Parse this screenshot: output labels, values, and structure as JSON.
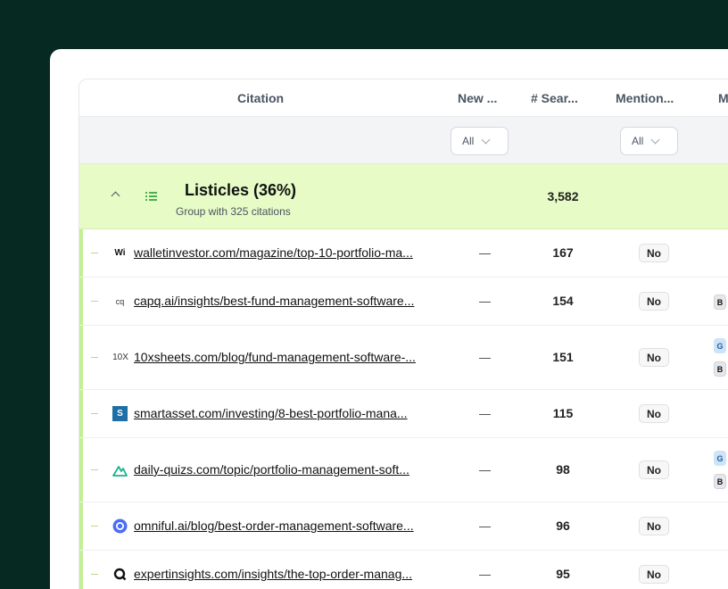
{
  "columns": {
    "citation": "Citation",
    "new": "New ...",
    "searches": "# Sear...",
    "mention": "Mention...",
    "more": "M"
  },
  "filters": {
    "new_value": "All",
    "mention_value": "All"
  },
  "group": {
    "title": "Listicles (36%)",
    "subtitle": "Group with 325 citations",
    "count": "3,582"
  },
  "rows": [
    {
      "favicon": "Wi",
      "url": "walletinvestor.com/magazine/top-10-portfolio-ma...",
      "searches": "167",
      "mention": "No"
    },
    {
      "favicon": "cq",
      "url": "capq.ai/insights/best-fund-management-software...",
      "searches": "154",
      "mention": "No"
    },
    {
      "favicon": "10X",
      "url": "10xsheets.com/blog/fund-management-software-...",
      "searches": "151",
      "mention": "No"
    },
    {
      "favicon": "S",
      "url": "smartasset.com/investing/8-best-portfolio-mana...",
      "searches": "115",
      "mention": "No"
    },
    {
      "favicon": "triangle",
      "url": "daily-quizs.com/topic/portfolio-management-soft...",
      "searches": "98",
      "mention": "No"
    },
    {
      "favicon": "circle",
      "url": "omniful.ai/blog/best-order-management-software...",
      "searches": "96",
      "mention": "No"
    },
    {
      "favicon": "q-circle",
      "url": "expertinsights.com/insights/the-top-order-manag...",
      "searches": "95",
      "mention": "No"
    }
  ],
  "colors": {
    "background": "#062a22",
    "group_bg": "#e6fbc6",
    "accent": "#c5ef96"
  }
}
